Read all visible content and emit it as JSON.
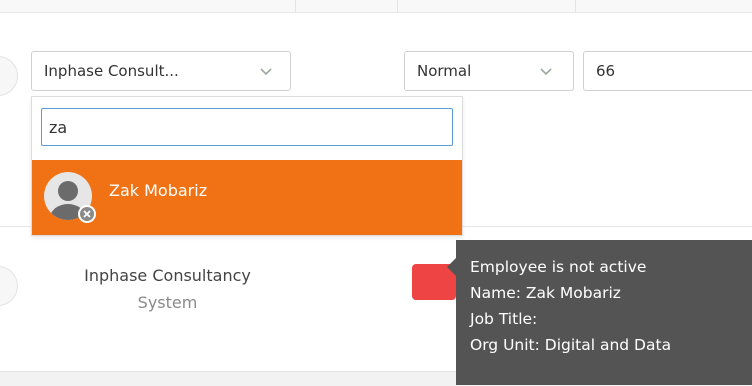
{
  "colors": {
    "accent_orange": "#F07214",
    "status_red": "#EF4444",
    "tooltip_bg": "#545454",
    "focus_blue": "#5B9BD5"
  },
  "filters": {
    "organisation": {
      "selected": "Inphase Consult...",
      "icon": "chevron-down-icon"
    },
    "search": {
      "value": "za"
    },
    "options": [
      {
        "label": "Zak Mobariz",
        "icon": "user-avatar-icon",
        "badge_icon": "inactive-badge-icon",
        "highlighted": true
      }
    ],
    "priority": {
      "selected": "Normal",
      "icon": "chevron-down-icon"
    },
    "value_field": "66"
  },
  "row": {
    "owner": "Inphase Consultancy",
    "owner_sub": "System",
    "status_color": "#EF4444"
  },
  "tooltip": {
    "lines": [
      "Employee is not active",
      "Name: Zak Mobariz",
      "Job Title:",
      "Org Unit: Digital and Data"
    ]
  }
}
